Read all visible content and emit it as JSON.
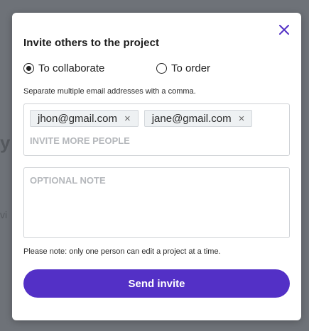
{
  "backdrop": {
    "fragment_1": "y",
    "fragment_2": "vi"
  },
  "modal": {
    "title": "Invite others to the project",
    "close_icon": "close-icon",
    "radios": [
      {
        "label": "To collaborate",
        "checked": true
      },
      {
        "label": "To order",
        "checked": false
      }
    ],
    "help_text": "Separate multiple email addresses with a comma.",
    "emails": [
      {
        "address": "jhon@gmail.com",
        "remove_glyph": "×"
      },
      {
        "address": "jane@gmail.com",
        "remove_glyph": "×"
      }
    ],
    "invite_placeholder": "INVITE MORE PEOPLE",
    "note_placeholder": "OPTIONAL NOTE",
    "footnote": "Please note: only one person can edit a project at a time.",
    "send_label": "Send invite"
  },
  "colors": {
    "accent": "#5330c6",
    "overlay": "#6e7278"
  }
}
